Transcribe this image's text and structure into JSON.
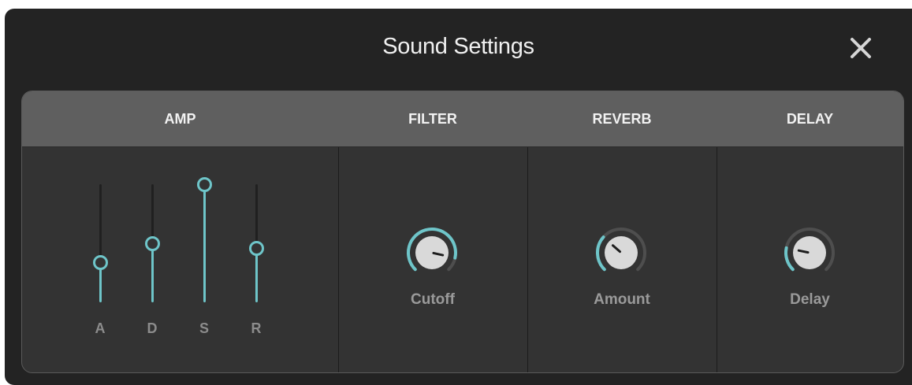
{
  "dialog": {
    "title": "Sound Settings",
    "close_icon": "close-icon"
  },
  "colors": {
    "accent": "#6ec5c9",
    "background": "#232323",
    "panel": "#333333",
    "header": "#5f5f5f"
  },
  "sections": {
    "amp": {
      "title": "AMP",
      "sliders": [
        {
          "label": "A",
          "value": 0.34
        },
        {
          "label": "D",
          "value": 0.5
        },
        {
          "label": "S",
          "value": 1.0
        },
        {
          "label": "R",
          "value": 0.46
        }
      ]
    },
    "filter": {
      "title": "FILTER",
      "knob": {
        "label": "Cutoff",
        "value": 0.88
      }
    },
    "reverb": {
      "title": "REVERB",
      "knob": {
        "label": "Amount",
        "value": 0.32
      }
    },
    "delay": {
      "title": "DELAY",
      "knob": {
        "label": "Delay",
        "value": 0.21
      }
    }
  }
}
